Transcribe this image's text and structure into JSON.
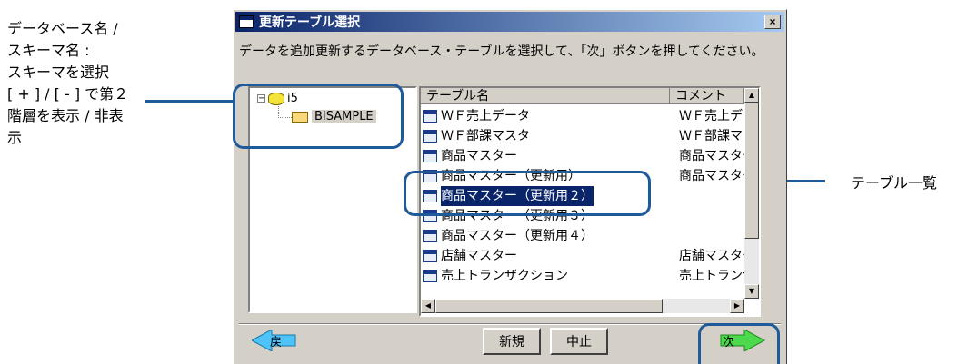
{
  "callout_left": {
    "lines": [
      "データベース名 /",
      "スキーマ名 :",
      "スキーマを選択",
      "[ + ] / [ - ] で第２",
      "階層を表示 / 非表",
      "示"
    ]
  },
  "callout_right": {
    "text": "テーブル一覧"
  },
  "dialog": {
    "title": "更新テーブル選択",
    "close_label": "×",
    "instruction": "データを追加更新するデータベース・テーブルを選択して、「次」ボタンを押してください。"
  },
  "tree": {
    "db": {
      "expander": "⊟",
      "label": "i5"
    },
    "schema": {
      "label": "BISAMPLE"
    }
  },
  "table_list": {
    "columns": [
      "テーブル名",
      "コメント"
    ],
    "rows": [
      {
        "name": "ＷＦ売上データ",
        "comment": "ＷＦ売上デ"
      },
      {
        "name": "ＷＦ部課マスタ",
        "comment": "ＷＦ部課マ"
      },
      {
        "name": "商品マスター",
        "comment": "商品マスター"
      },
      {
        "name": "商品マスター（更新用）",
        "comment": "商品マスター"
      },
      {
        "name": "商品マスター（更新用２）",
        "comment": "",
        "selected": true
      },
      {
        "name": "商品マスター（更新用３）",
        "comment": ""
      },
      {
        "name": "商品マスター（更新用４）",
        "comment": ""
      },
      {
        "name": "店舗マスター",
        "comment": "店舗マスター"
      },
      {
        "name": "売上トランザクション",
        "comment": "売上トランザ"
      }
    ]
  },
  "buttons": {
    "back_label": "戻",
    "new_label": "新規",
    "cancel_label": "中止",
    "next_label": "次"
  },
  "colors": {
    "accent": "#1f5a9a",
    "selection": "#0a246a",
    "arrow": "#4fc3f7"
  }
}
